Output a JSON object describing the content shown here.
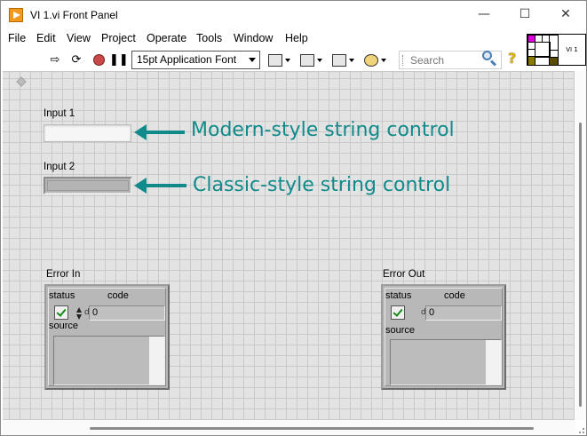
{
  "window": {
    "title": "VI 1.vi Front Panel",
    "minimize_glyph": "—",
    "maximize_glyph": "☐",
    "close_glyph": "✕"
  },
  "menu": {
    "items": [
      "File",
      "Edit",
      "View",
      "Project",
      "Operate",
      "Tools",
      "Window",
      "Help"
    ]
  },
  "toolbar": {
    "font_select_value": "15pt Application Font",
    "search_placeholder": "Search",
    "icons": [
      "run-arrow-icon",
      "run-continuously-icon",
      "abort-icon",
      "pause-icon",
      "align-objects-icon",
      "distribute-objects-icon",
      "resize-objects-icon",
      "reorder-icon",
      "search-icon",
      "context-help-icon"
    ]
  },
  "vi_icon": {
    "text": "VI 1"
  },
  "controls": {
    "input1": {
      "label": "Input 1",
      "value": ""
    },
    "input2": {
      "label": "Input 2",
      "value": ""
    }
  },
  "annotations": {
    "modern": "Modern-style string control",
    "classic": "Classic-style string control",
    "color": "#108a8a"
  },
  "error_in": {
    "label": "Error In",
    "status_label": "status",
    "code_label": "code",
    "code_value": "0",
    "source_label": "source",
    "radix": "d",
    "status_checked": true
  },
  "error_out": {
    "label": "Error Out",
    "status_label": "status",
    "code_label": "code",
    "code_value": "0",
    "source_label": "source",
    "radix": "d",
    "status_checked": true
  }
}
